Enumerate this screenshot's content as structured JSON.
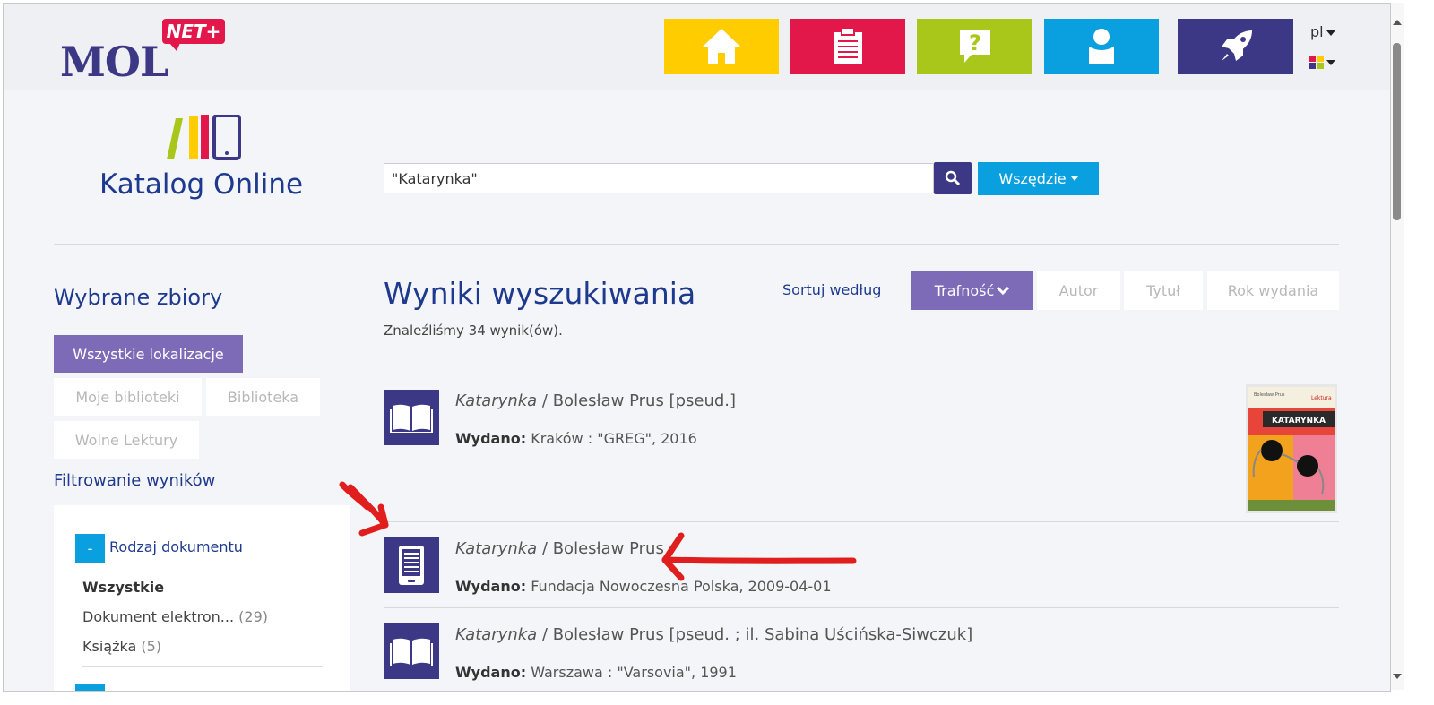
{
  "header": {
    "logo_text": "MOL",
    "logo_badge": "NET+",
    "nav": [
      {
        "name": "home-icon",
        "color": "#ffcc00"
      },
      {
        "name": "clipboard-icon",
        "color": "#e2184a"
      },
      {
        "name": "question-icon",
        "color": "#a9c71b"
      },
      {
        "name": "user-icon",
        "color": "#0aa0e0"
      },
      {
        "name": "rocket-icon",
        "color": "#3d3886"
      }
    ],
    "lang": "pl"
  },
  "catalog": {
    "title": "Katalog Online"
  },
  "search": {
    "query": "\"Katarynka\"",
    "scope_label": "Wszędzie"
  },
  "sidebar": {
    "title": "Wybrane zbiory",
    "buttons": [
      "Wszystkie lokalizacje",
      "Moje biblioteki",
      "Biblioteka",
      "Wolne Lektury"
    ],
    "filter_title": "Filtrowanie wyników",
    "filter_toggle": "-",
    "filter_group": "Rodzaj dokumentu",
    "facets": [
      {
        "label": "Wszystkie",
        "count": ""
      },
      {
        "label": "Dokument elektron...",
        "count": "(29)"
      },
      {
        "label": "Książka",
        "count": "(5)"
      }
    ]
  },
  "results": {
    "title": "Wyniki wyszukiwania",
    "count_text": "Znaleźliśmy 34 wynik(ów).",
    "sort_label": "Sortuj według",
    "sort_options": [
      "Trafność",
      "Autor",
      "Tytuł",
      "Rok wydania"
    ],
    "published_label": "Wydano:",
    "items": [
      {
        "title": "Katarynka",
        "author": " / Bolesław Prus [pseud.]",
        "published": " Kraków : \"GREG\", 2016",
        "icon": "book-icon"
      },
      {
        "title": "Katarynka",
        "author": " / Bolesław Prus",
        "published": " Fundacja Nowoczesna Polska, 2009-04-01",
        "icon": "ebook-reader-icon"
      },
      {
        "title": "Katarynka",
        "author": " / Bolesław Prus [pseud. ; il. Sabina Uścińska-Siwczuk]",
        "published": " Warszawa : \"Varsovia\", 1991",
        "icon": "book-icon"
      }
    ],
    "cover": {
      "author": "Bolesław Prus",
      "series": "Lektura",
      "title": "KATARYNKA"
    }
  },
  "colors": {
    "brand": "#3d3886",
    "accent": "#7e6bb8",
    "link": "#1e3a8e",
    "annotation": "#e01e1e"
  }
}
